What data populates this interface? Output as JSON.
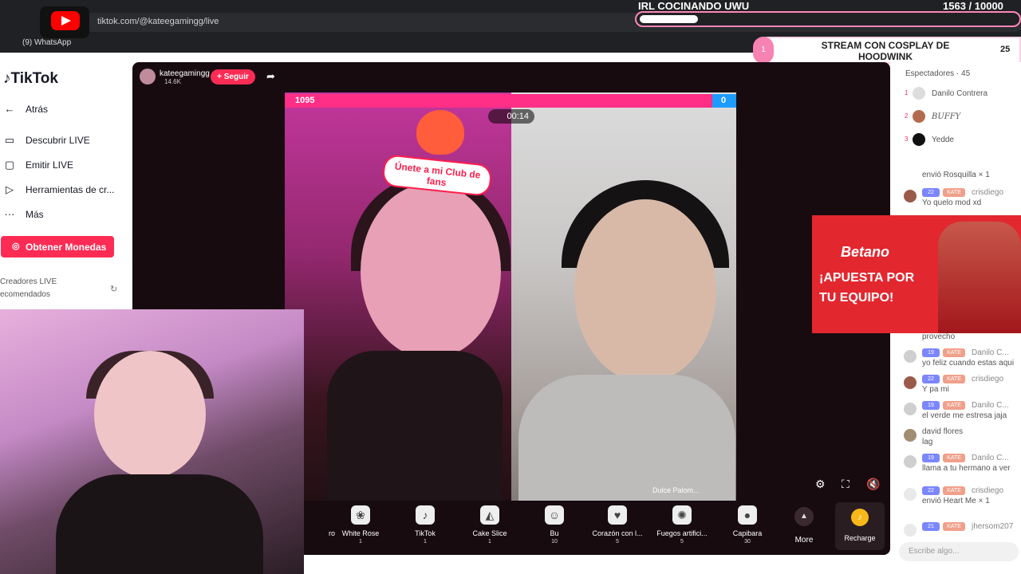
{
  "browser": {
    "url": "tiktok.com/@kateegamingg/live",
    "bookmark": "(9) WhatsApp"
  },
  "goal": {
    "title": "IRL COCINANDO UWU",
    "count": "1563  / 10000",
    "progress": 0.1563
  },
  "cosplay": {
    "bubble": "1",
    "text": "STREAM CON COSPLAY DE HOODWINK",
    "count": "25"
  },
  "sidebar": {
    "logo": "TikTok",
    "items": [
      {
        "icon": "back-arrow-icon",
        "label": "Atrás"
      },
      {
        "icon": "tv-icon",
        "label": "Descubrir LIVE"
      },
      {
        "icon": "camera-icon",
        "label": "Emitir LIVE"
      },
      {
        "icon": "play-box-icon",
        "label": "Herramientas de cr..."
      },
      {
        "icon": "more-dots-icon",
        "label": "Más"
      }
    ],
    "coins_button": "Obtener Monedas",
    "recommended_line1": "Creadores LIVE",
    "recommended_line2": "ecomendados"
  },
  "live": {
    "host_name": "kateegamingg",
    "host_views": "14.6K",
    "follow": "+ Seguir",
    "battle_left": "1095",
    "battle_right": "0",
    "timer": "00:14",
    "fanclub": "Únete a mi Club de fans",
    "right_tag": "Dulce Palom..."
  },
  "gifts": [
    {
      "name": "ro",
      "price": ""
    },
    {
      "name": "White Rose",
      "price": "1"
    },
    {
      "name": "TikTok",
      "price": "1"
    },
    {
      "name": "Cake Slice",
      "price": "1"
    },
    {
      "name": "Bu",
      "price": "10"
    },
    {
      "name": "Corazón con l...",
      "price": "5"
    },
    {
      "name": "Fuegos artifici...",
      "price": "5"
    },
    {
      "name": "Capibara",
      "price": "30"
    }
  ],
  "more_label": "More",
  "recharge_label": "Recharge",
  "chat": {
    "viewers_title": "Espectadores · 45",
    "viewers": [
      {
        "rank": "1",
        "name": "Danilo Contrera"
      },
      {
        "rank": "2",
        "name": "BUFFY"
      },
      {
        "rank": "3",
        "name": "Yedde"
      }
    ],
    "messages": [
      {
        "badge1": "",
        "badge2": "",
        "user": "",
        "text": "envió Rosquilla × 1"
      },
      {
        "badge1": "22",
        "badge2": "KATE",
        "user": "crisdiego",
        "text": "Yo quelo mod xd"
      },
      {
        "badge1": "",
        "badge2": "",
        "user": "",
        "text": "provecho"
      },
      {
        "badge1": "19",
        "badge2": "KATE",
        "user": "Danilo C...",
        "text": "yo feliz cuando estas aqui"
      },
      {
        "badge1": "22",
        "badge2": "KATE",
        "user": "crisdiego",
        "text": "Y pa mi"
      },
      {
        "badge1": "19",
        "badge2": "KATE",
        "user": "Danilo C...",
        "text": "el verde me estresa jaja"
      },
      {
        "badge1": "",
        "badge2": "",
        "user": "david flores",
        "text": "lag"
      },
      {
        "badge1": "19",
        "badge2": "KATE",
        "user": "Danilo C...",
        "text": "llama a tu hermano a ver"
      },
      {
        "badge1": "22",
        "badge2": "KATE",
        "user": "crisdiego",
        "text": "envió Heart Me × 1"
      },
      {
        "badge1": "21",
        "badge2": "KATE",
        "user": "jhersom207",
        "text": ""
      }
    ],
    "input_placeholder": "Escribe algo..."
  },
  "ad": {
    "brand": "Betano",
    "tagline": "¡APUESTA POR TU EQUIPO!"
  }
}
